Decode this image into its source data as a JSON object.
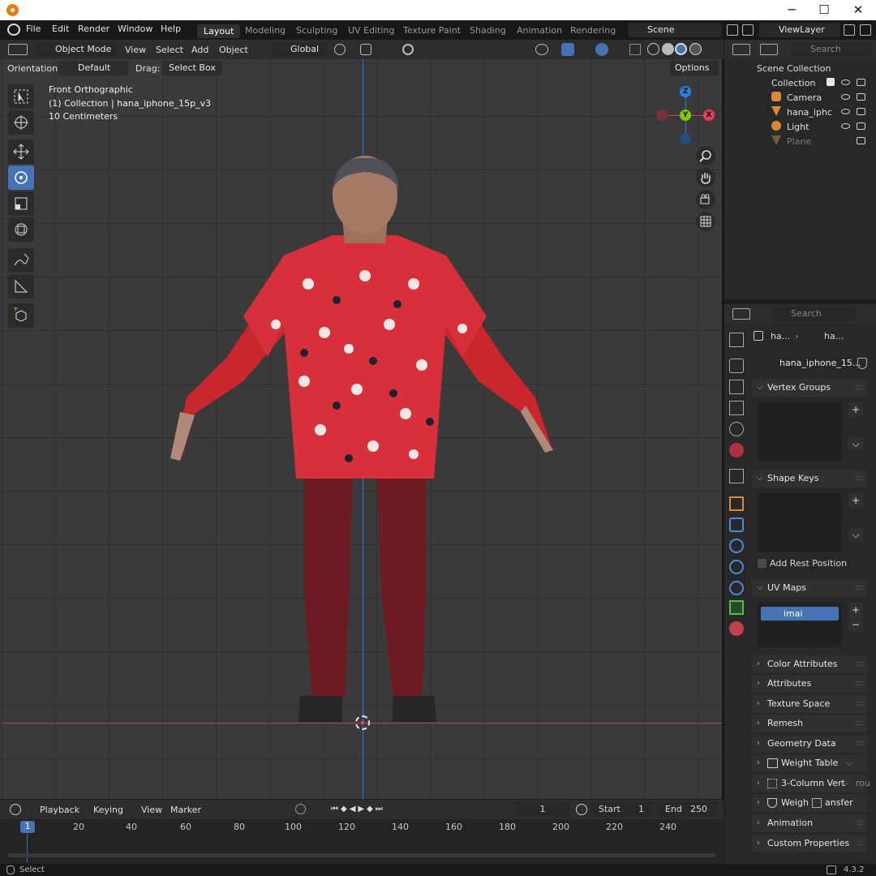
{
  "window": {
    "minimize": "─",
    "maximize": "☐",
    "close": "✕"
  },
  "topmenu": [
    "File",
    "Edit",
    "Render",
    "Window",
    "Help"
  ],
  "workspace_tabs": [
    "Layout",
    "Modeling",
    "Sculpting",
    "UV Editing",
    "Texture Paint",
    "Shading",
    "Animation",
    "Rendering"
  ],
  "active_tab": "Layout",
  "scene": "Scene",
  "view_layer": "ViewLayer",
  "outliner_search_placeholder": "Search",
  "viewport_header": {
    "mode": "Object Mode",
    "menus": [
      "View",
      "Select",
      "Add",
      "Object"
    ],
    "transform": "Global"
  },
  "tool_settings": {
    "orientation_label": "Orientation:",
    "orientation_value": "Default",
    "drag_label": "Drag:",
    "drag_value": "Select Box",
    "options": "Options"
  },
  "overlay_text": {
    "view": "Front Orthographic",
    "collection": "(1) Collection | hana_iphone_15p_v3",
    "scale": "10 Centimeters"
  },
  "gizmo": {
    "z": "Z",
    "y": "Y",
    "x": "X"
  },
  "outliner": {
    "scene_collection": "Scene Collection",
    "collection": "Collection",
    "items": [
      "Camera",
      "hana_iphc",
      "Light",
      "Plane"
    ]
  },
  "properties": {
    "search_placeholder": "Search",
    "breadcrumb_1": "ha...",
    "breadcrumb_2": "ha...",
    "mesh_name": "hana_iphone_15...",
    "panels": {
      "vertex_groups": "Vertex Groups",
      "shape_keys": "Shape Keys",
      "add_rest_position": "Add Rest Position",
      "uv_maps": "UV Maps",
      "uv_map_item": "imai",
      "color_attributes": "Color Attributes",
      "attributes": "Attributes",
      "texture_space": "Texture Space",
      "remesh": "Remesh",
      "geometry_data": "Geometry Data",
      "weight_table": "Weight Table",
      "three_column": "3-Column Vert",
      "three_column_tail": "rou",
      "weight_transfer_a": "Weigh",
      "weight_transfer_b": "ansfer",
      "animation": "Animation",
      "custom_properties": "Custom Properties"
    }
  },
  "timeline": {
    "menus": [
      "Playback",
      "Keying",
      "View",
      "Marker"
    ],
    "current_frame": "1",
    "start_label": "Start",
    "start_value": "1",
    "end_label": "End",
    "end_value": "250",
    "ruler": [
      "1",
      "20",
      "40",
      "60",
      "80",
      "100",
      "120",
      "140",
      "160",
      "180",
      "200",
      "220",
      "240"
    ]
  },
  "status": {
    "left": "Select",
    "version": "4.3.2"
  },
  "colors": {
    "accent": "#4772b3",
    "x_axis": "#e63e55",
    "y_axis": "#7fc900",
    "z_axis": "#2b7fe0",
    "shirt": "#d8303a",
    "pants": "#7a1a22"
  }
}
